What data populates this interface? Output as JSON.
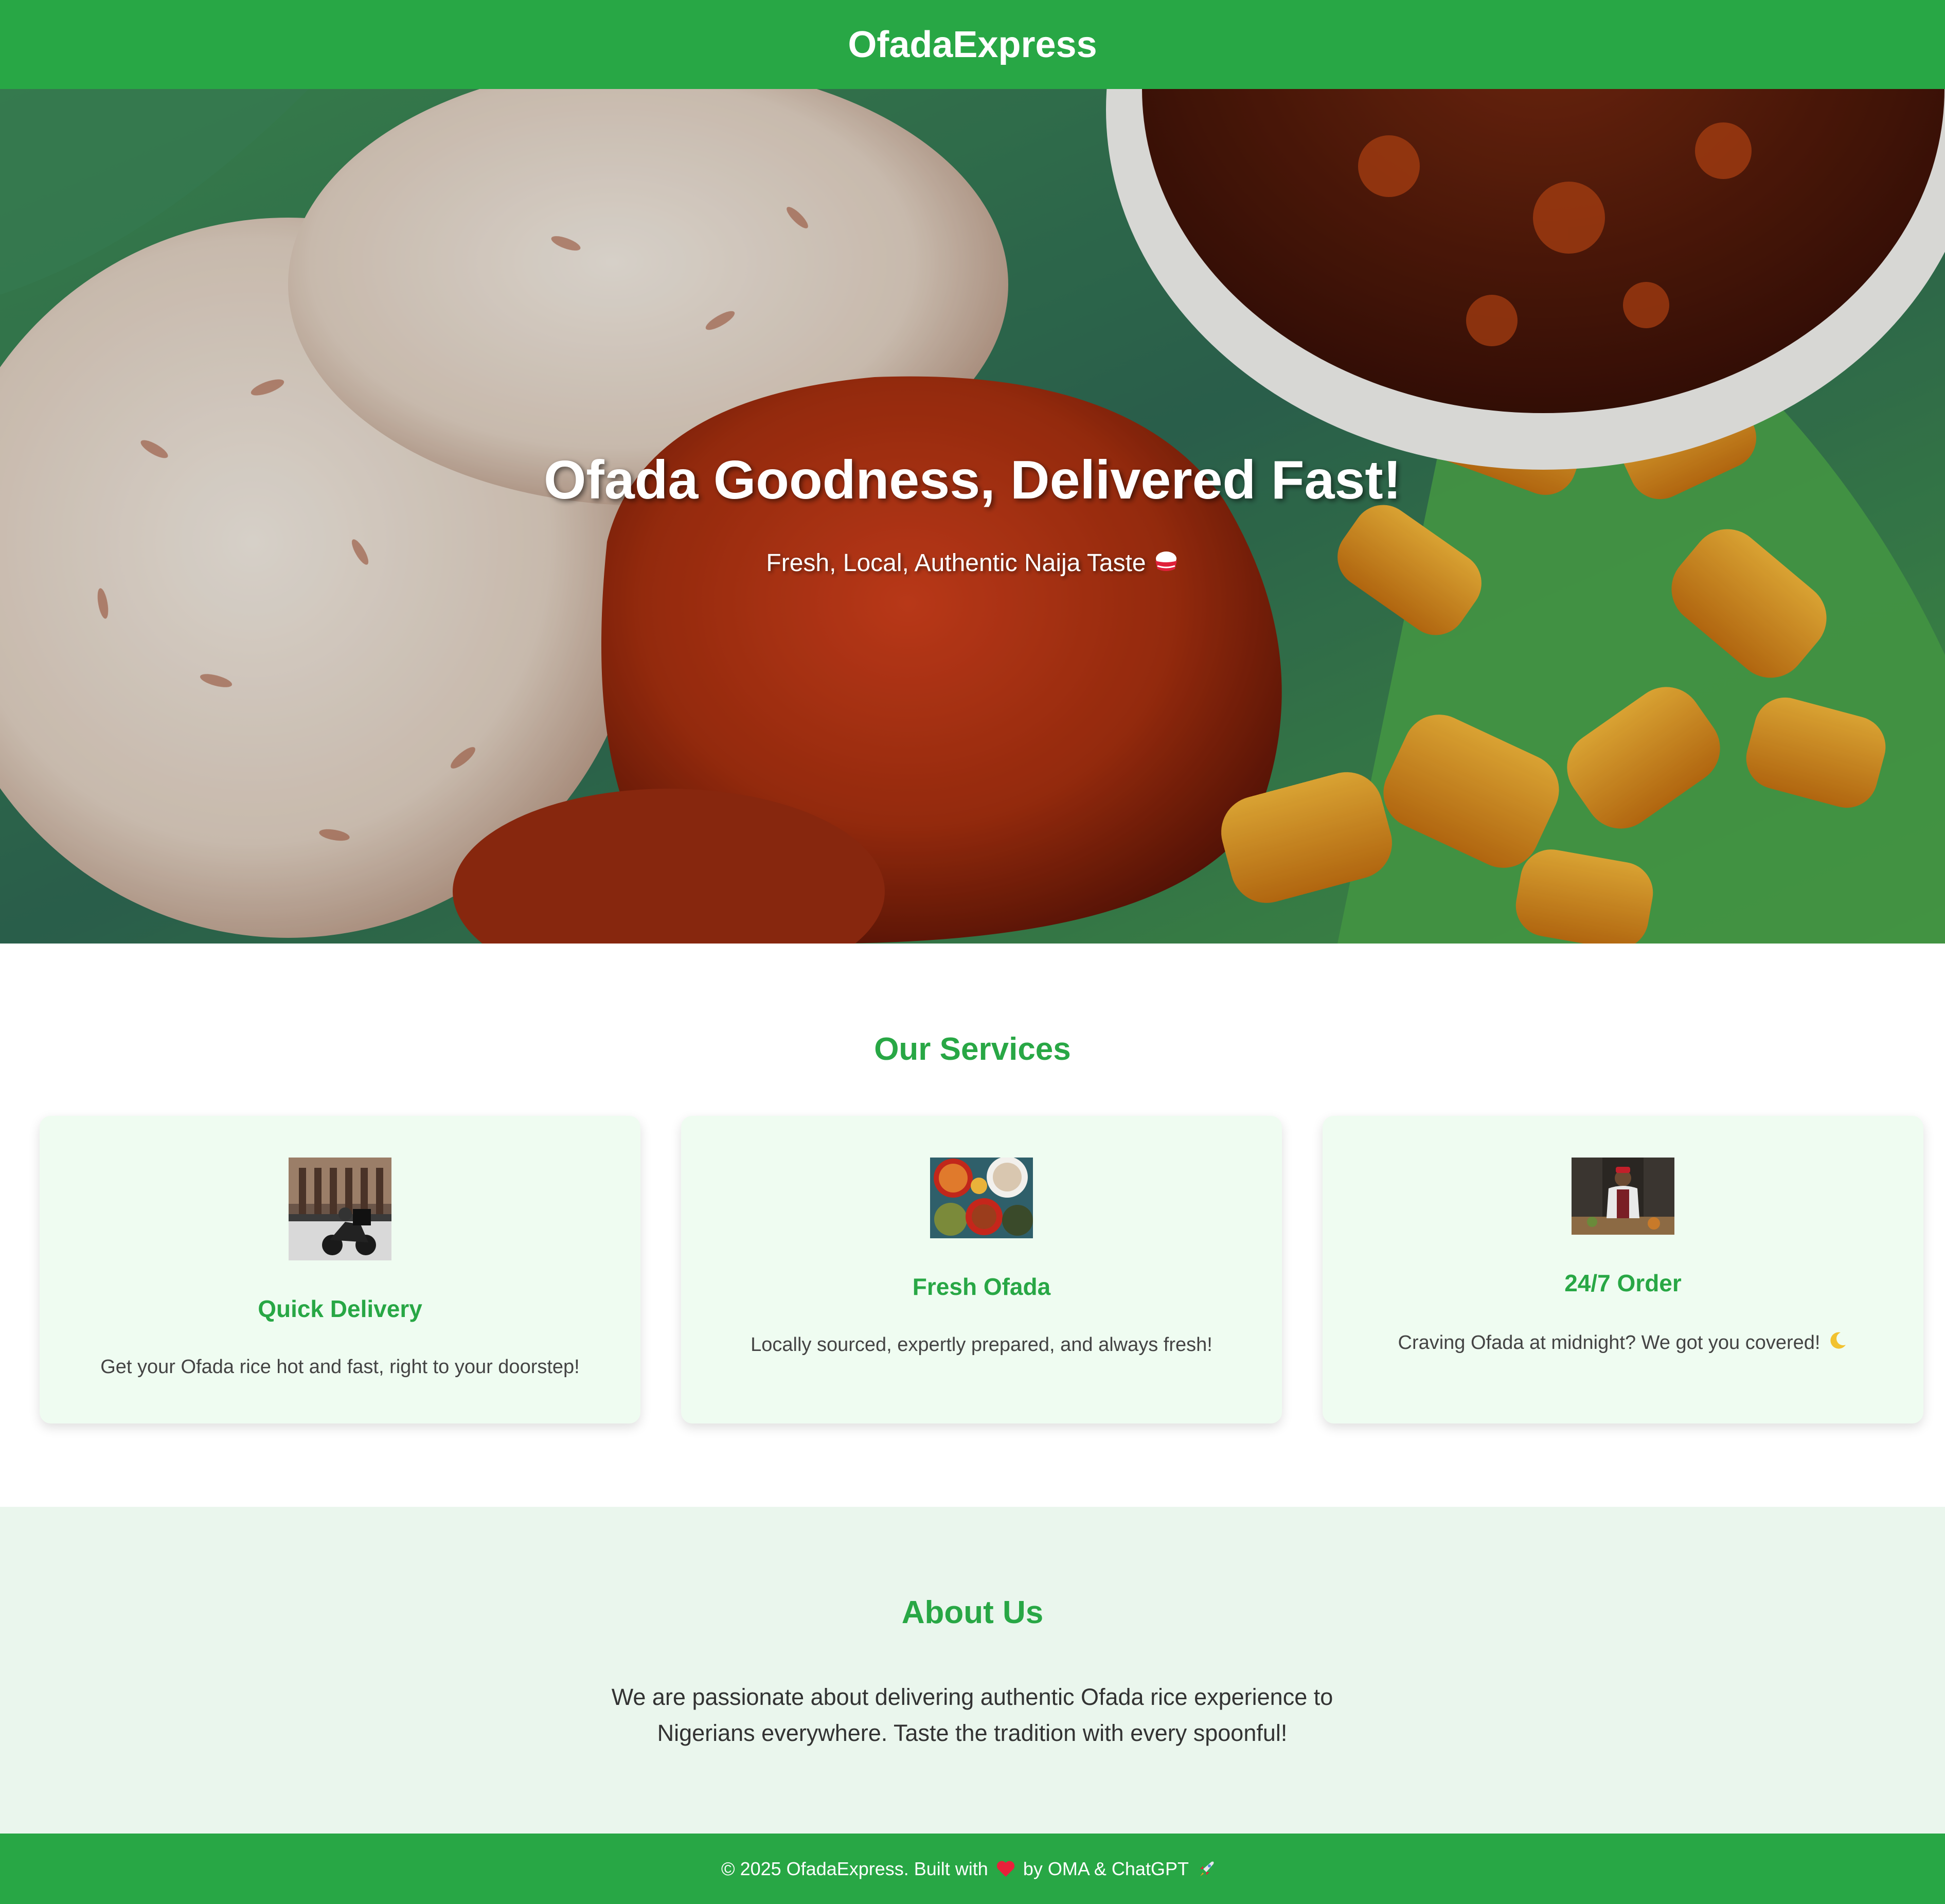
{
  "header": {
    "brand": "OfadaExpress"
  },
  "hero": {
    "title": "Ofada Goodness, Delivered Fast!",
    "subtitle": "Fresh, Local, Authentic Naija Taste",
    "subtitle_icon": "rice-bowl-icon"
  },
  "services": {
    "title": "Our Services",
    "cards": [
      {
        "image": "delivery-rider-image",
        "title": "Quick Delivery",
        "text": "Get your Ofada rice hot and fast, right to your doorstep!"
      },
      {
        "image": "food-platter-image",
        "title": "Fresh Ofada",
        "text": "Locally sourced, expertly prepared, and always fresh!"
      },
      {
        "image": "chef-image",
        "title": "24/7 Order",
        "text": "Craving Ofada at midnight? We got you covered!",
        "icon": "moon-icon"
      }
    ]
  },
  "about": {
    "title": "About Us",
    "text": "We are passionate about delivering authentic Ofada rice experience to Nigerians everywhere. Taste the tradition with every spoonful!"
  },
  "footer": {
    "text_before": "© 2025 OfadaExpress. Built with",
    "text_after": "by OMA & ChatGPT",
    "icons": [
      "heart-icon",
      "rocket-icon"
    ]
  },
  "colors": {
    "brand_green": "#28a745",
    "card_bg": "#effcf1",
    "about_bg": "#eaf6ed"
  }
}
